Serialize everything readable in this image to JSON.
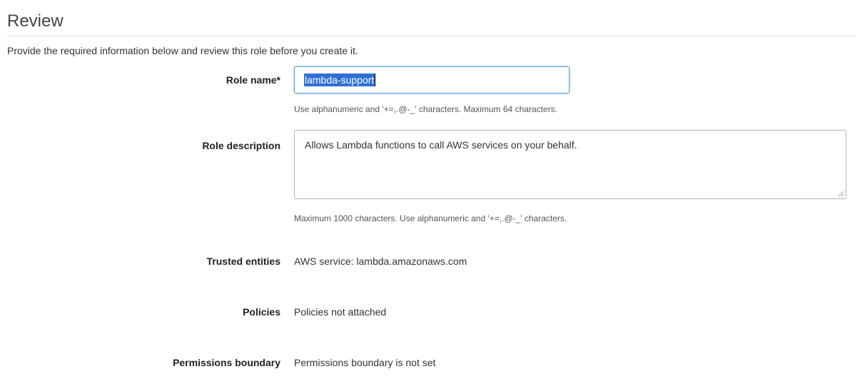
{
  "header": {
    "title": "Review",
    "intro": "Provide the required information below and review this role before you create it."
  },
  "form": {
    "role_name": {
      "label": "Role name*",
      "value": "lambda-support",
      "hint": "Use alphanumeric and '+=,.@-_' characters. Maximum 64 characters."
    },
    "role_description": {
      "label": "Role description",
      "value": "Allows Lambda functions to call AWS services on your behalf.",
      "hint": "Maximum 1000 characters. Use alphanumeric and '+=,.@-_' characters."
    },
    "trusted_entities": {
      "label": "Trusted entities",
      "value": "AWS service: lambda.amazonaws.com"
    },
    "policies": {
      "label": "Policies",
      "value": "Policies not attached"
    },
    "permissions_boundary": {
      "label": "Permissions boundary",
      "value": "Permissions boundary is not set"
    }
  },
  "colors": {
    "input_focus_border": "#5b9dd9",
    "selection_highlight": "#2f6fd6"
  },
  "icons": {
    "textarea_resize": "resize-grip-icon"
  }
}
